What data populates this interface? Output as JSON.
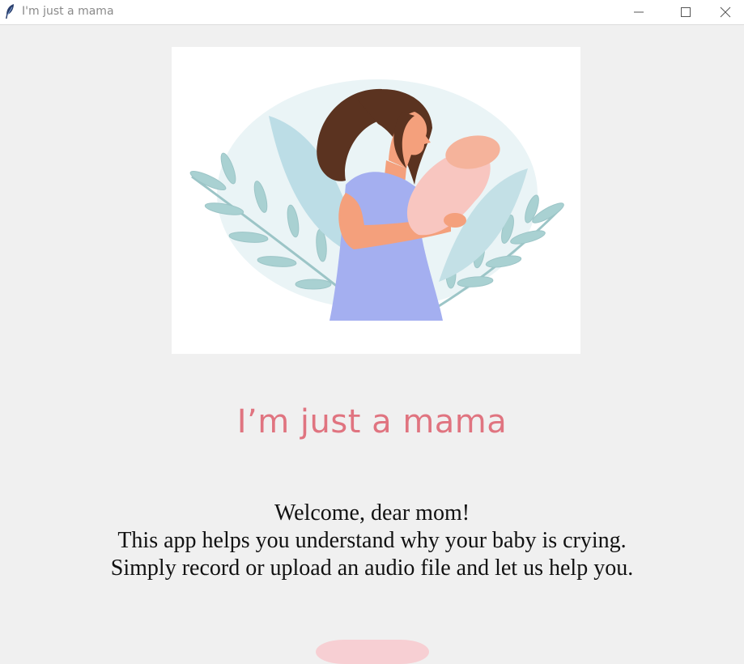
{
  "window": {
    "title": "I'm just a mama",
    "app_icon": "feather-icon",
    "controls": [
      "minimize-icon",
      "maximize-icon",
      "close-icon"
    ]
  },
  "hero_image": {
    "subject": "mother-holding-baby-illustration",
    "colors": {
      "dress": "#a4aff0",
      "hair": "#5b3320",
      "skin": "#f4a07c",
      "blanket": "#f8c6c0",
      "leaves": "#a9d1d2",
      "halo": "#e9f4f6"
    }
  },
  "main": {
    "heading": "I’m just a mama",
    "welcome_lines": [
      "Welcome, dear mom!",
      "This app helps you understand why your baby is crying.",
      "Simply record or upload an audio file and let us help you."
    ]
  },
  "colors": {
    "accent": "#e07480",
    "background": "#f0f0f0",
    "button_partial": "#f7cfd3"
  }
}
